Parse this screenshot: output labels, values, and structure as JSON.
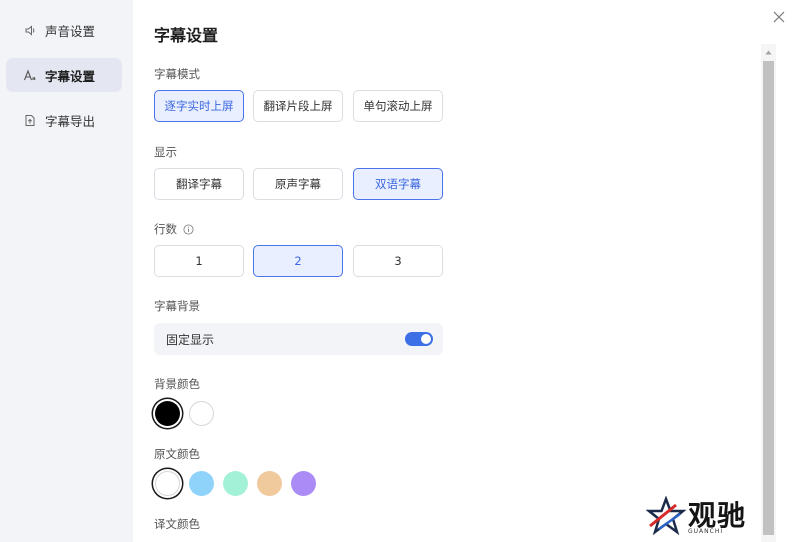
{
  "sidebar": {
    "items": [
      {
        "label": "声音设置",
        "icon": "speaker-icon",
        "active": false
      },
      {
        "label": "字幕设置",
        "icon": "text-style-icon",
        "active": true
      },
      {
        "label": "字幕导出",
        "icon": "export-icon",
        "active": false
      }
    ]
  },
  "page": {
    "title": "字幕设置"
  },
  "mode": {
    "label": "字幕模式",
    "options": [
      "逐字实时上屏",
      "翻译片段上屏",
      "单句滚动上屏"
    ],
    "selected": "逐字实时上屏"
  },
  "display": {
    "label": "显示",
    "options": [
      "翻译字幕",
      "原声字幕",
      "双语字幕"
    ],
    "selected": "双语字幕"
  },
  "lines": {
    "label": "行数",
    "options": [
      "1",
      "2",
      "3"
    ],
    "selected": "2"
  },
  "background": {
    "label": "字幕背景",
    "toggle_label": "固定显示",
    "toggle_on": true
  },
  "bg_color": {
    "label": "背景颜色",
    "colors": [
      "#000000",
      "#ffffff"
    ],
    "selected": "#000000"
  },
  "source_color": {
    "label": "原文颜色",
    "colors": [
      "#ffffff",
      "#8fd3fb",
      "#a3f2d8",
      "#f0c99c",
      "#ab8cf6"
    ],
    "selected": "#ffffff"
  },
  "translation_color": {
    "label": "译文颜色"
  },
  "watermark": {
    "text": "观驰",
    "sub": "GUANCHI"
  },
  "colors": {
    "accent": "#3d6fe6",
    "selected_bg": "#e9efff",
    "sidebar_bg": "#f3f4f8"
  }
}
